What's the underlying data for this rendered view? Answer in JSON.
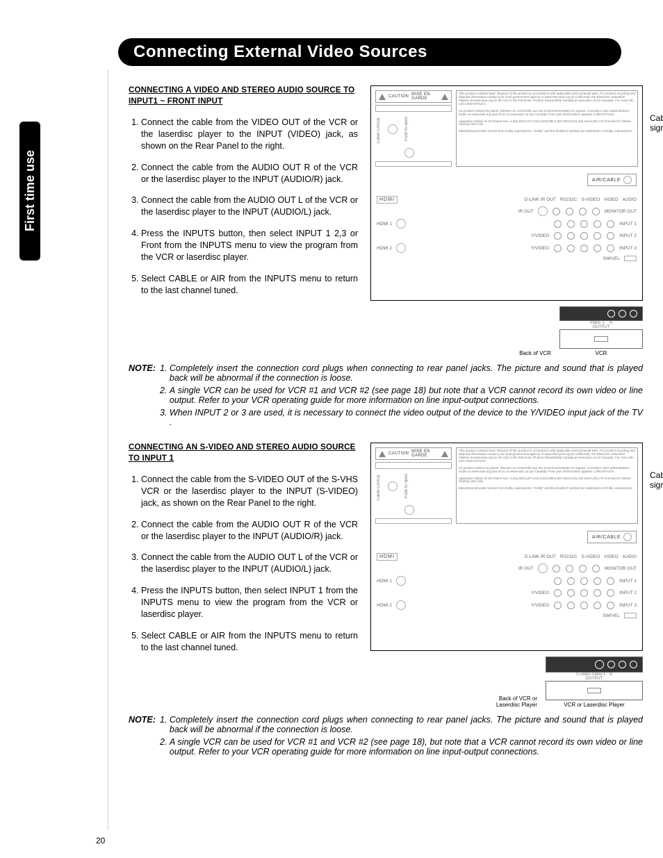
{
  "page_number": "20",
  "side_tab": "First time use",
  "title": "Connecting External Video Sources",
  "section1": {
    "heading": "CONNECTING A VIDEO AND STEREO AUDIO SOURCE TO INPUT1 ~ FRONT INPUT",
    "steps": [
      "Connect the cable from the VIDEO OUT of the VCR or the laserdisc player to the INPUT (VIDEO) jack, as shown on the Rear Panel to the right.",
      "Connect the cable from the AUDIO OUT R of the VCR or the laserdisc player to the INPUT (AUDIO/R) jack.",
      "Connect the cable from the AUDIO OUT L of the VCR or the laserdisc player to the INPUT (AUDIO/L) jack.",
      "Press the INPUTS button, then select INPUT 1 2,3 or Front from the INPUTS menu to view the program from the VCR or laserdisc player.",
      "Select CABLE or AIR from the INPUTS menu to return to the last channel tuned."
    ],
    "diagram": {
      "cable_label": "Cable or Air signal",
      "caution": "CAUTION",
      "mise_en_garde": "MISE EN GARDE",
      "air_cable": "AIR/CABLE",
      "hdmi": "HDMI",
      "hdmi1": "HDMI 1",
      "hdmi2": "HDMI 2",
      "ir_out": "IR OUT",
      "dlink": "D-LINK IR OUT",
      "rs232c": "RS232C",
      "svideo": "S-VIDEO",
      "video": "VIDEO",
      "audio": "AUDIO",
      "monitor_out": "MONITOR OUT",
      "input1": "INPUT 1",
      "input2": "INPUT 2",
      "input3": "INPUT 3",
      "yvideo": "Y/VIDEO",
      "swivel": "SWIVEL",
      "back_of_vcr": "Back of VCR",
      "vcr_jacks": "Video  L    R\nOUTPUT",
      "vcr_caption": "VCR"
    }
  },
  "note1": {
    "label": "NOTE:",
    "items": [
      "Completely insert the connection cord plugs when connecting to rear panel jacks. The picture and sound that is played back will be abnormal if the connection is loose.",
      "A single VCR can be used for VCR #1 and VCR #2 (see page 18) but note that a VCR cannot record its own video or line output. Refer to your VCR operating guide for more information on line input-output connections.",
      "When INPUT 2 or 3 are used, it is necessary to connect the video output of the device to the Y/VIDEO input jack of the TV ."
    ]
  },
  "section2": {
    "heading": "CONNECTING AN S-VIDEO AND STEREO AUDIO SOURCE TO INPUT 1",
    "steps": [
      "Connect the cable from the S-VIDEO OUT of the S-VHS VCR or the laserdisc player to the INPUT (S-VIDEO) jack, as shown on the Rear Panel to the right.",
      "Connect the cable from the AUDIO OUT R of the VCR or the laserdisc player to the INPUT (AUDIO/R) jack.",
      "Connect the cable from the AUDIO OUT L of the VCR or the laserdisc player to the INPUT (AUDIO/L) jack.",
      "Press the INPUTS button, then select INPUT 1 from the INPUTS menu to view the program from the VCR or laserdisc player.",
      "Select CABLE or AIR from the INPUTS menu to return to the last channel tuned."
    ],
    "diagram": {
      "cable_label": "Cable or Air signal",
      "back_of_vcr": "Back of VCR or Laserdisc Player",
      "vcr_jacks": "S-Video Video L   R\nOUTPUT",
      "vcr_caption": "VCR or Laserdisc Player"
    }
  },
  "note2": {
    "label": "NOTE:",
    "items": [
      "Completely insert the connection cord plugs when connecting to rear panel jacks. The picture and sound that is played back will be abnormal if the connection is loose.",
      "A single VCR can be used for VCR #1 and VCR #2 (see page 18), but note that a VCR cannot record its own video or line output. Refer to your VCR operating guide for more information on line input-output connections."
    ]
  }
}
